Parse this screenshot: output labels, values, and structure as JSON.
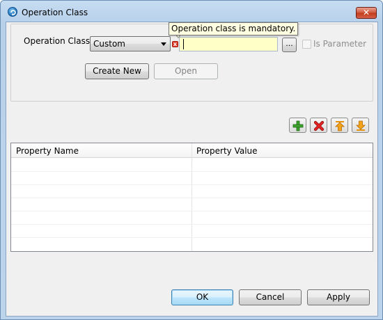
{
  "window": {
    "title": "Operation Class",
    "close_label": "✕"
  },
  "form": {
    "operation_class_label": "Operation Class",
    "type_select_value": "Custom",
    "class_input_value": "",
    "browse_label": "...",
    "is_parameter_label": "Is Parameter",
    "is_parameter_checked": false,
    "create_new_label": "Create New",
    "open_label": "Open"
  },
  "validation": {
    "tooltip": "Operation class is mandatory.",
    "error_mark": "x"
  },
  "toolbar": {
    "icons": [
      "add-icon",
      "delete-icon",
      "move-up-icon",
      "move-down-icon"
    ]
  },
  "table": {
    "columns": [
      "Property Name",
      "Property Value"
    ],
    "rows": []
  },
  "buttons": {
    "ok_label": "OK",
    "cancel_label": "Cancel",
    "apply_label": "Apply"
  }
}
